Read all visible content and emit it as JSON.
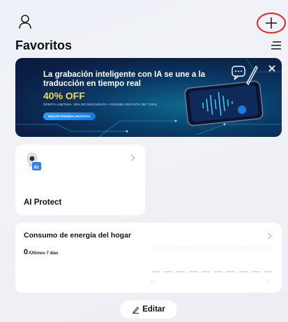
{
  "header": {
    "title": "Favoritos",
    "profile_icon": "user-icon",
    "add_icon": "plus-icon",
    "menu_icon": "hamburger-menu-icon",
    "annotation_color": "#e0262b"
  },
  "banner": {
    "headline": "La grabación inteligente con IA se une a la traducción en tiempo real",
    "price": "40% OFF",
    "fine_print": "OFERTA LIMITADA: 40% DE DESCUENTO + PRUEBA GRATUITA DE 7 DÍAS",
    "cta": "INICIAR PRUEBA GRATUITA",
    "close_icon": "close-icon",
    "accent_color": "#ffd84a"
  },
  "device_card": {
    "name": "AI Protect",
    "icon": "camera-ai-icon"
  },
  "energy_card": {
    "title": "Consumo de energía del hogar",
    "value": "0",
    "period": "/Últimos 7 días"
  },
  "footer": {
    "edit_label": "Editar",
    "edit_icon": "pencil-icon"
  }
}
